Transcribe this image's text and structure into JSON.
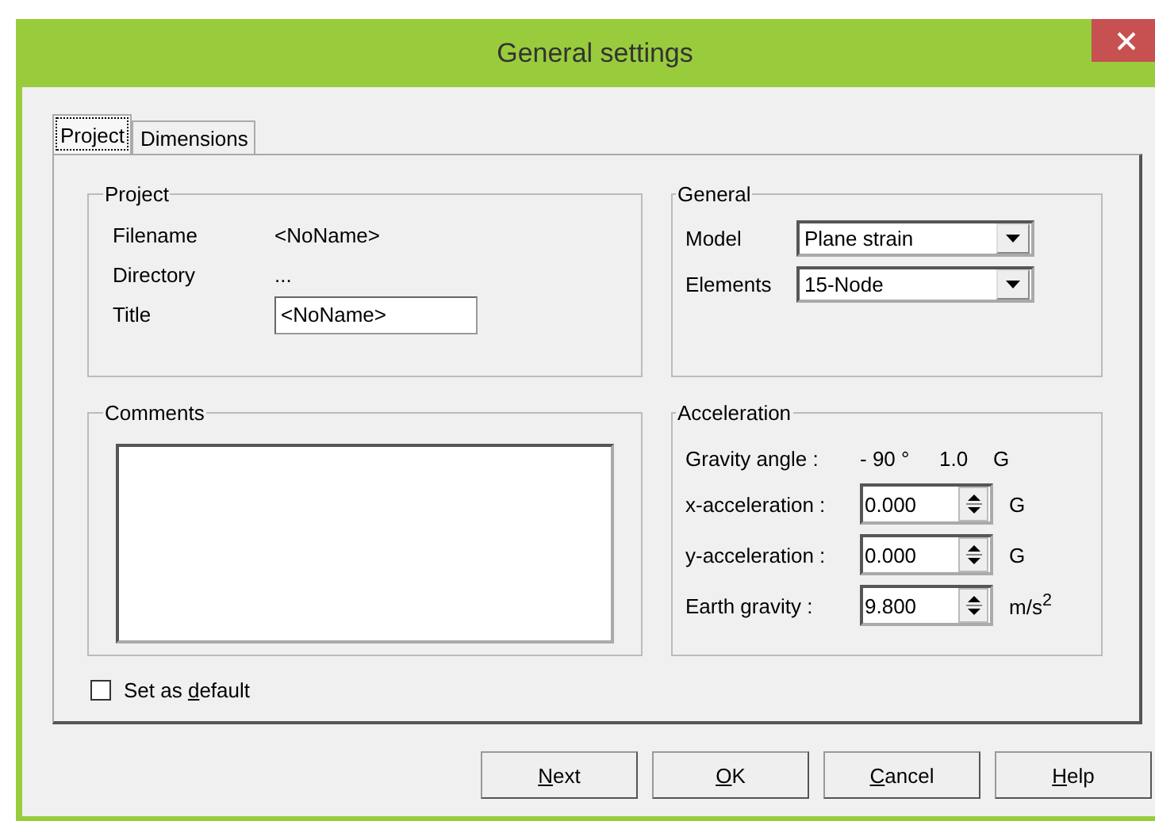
{
  "window": {
    "title": "General settings"
  },
  "tabs": [
    {
      "label": "Project",
      "selected": true
    },
    {
      "label": "Dimensions",
      "selected": false
    }
  ],
  "project": {
    "title": "Project",
    "filename_label": "Filename",
    "filename": "<NoName>",
    "directory_label": "Directory",
    "directory": "...",
    "title_label": "Title",
    "title_value": "<NoName>"
  },
  "general": {
    "title": "General",
    "fields": [
      {
        "label": "Model",
        "value": "Plane strain"
      },
      {
        "label": "Elements",
        "value": "15-Node"
      }
    ]
  },
  "comments": {
    "title": "Comments"
  },
  "acceleration": {
    "title": "Acceleration",
    "gravity_angle_label": "Gravity angle :",
    "gravity_angle": "- 90 °",
    "gravity_value": "1.0",
    "gravity_unit": "G",
    "fields": [
      {
        "label": "x-acceleration :",
        "value": "0.000",
        "unit": "G"
      },
      {
        "label": "y-acceleration :",
        "value": "0.000",
        "unit": "G"
      },
      {
        "label": "Earth gravity :",
        "value": "9.800",
        "unit": "m/s$^{2}$"
      }
    ]
  },
  "set_as_default": {
    "before": "Set as ",
    "hotkey": "d",
    "after": "efault",
    "checked": false
  },
  "buttons": [
    {
      "hotkey": "N",
      "after": "ext"
    },
    {
      "hotkey": "O",
      "after": "K"
    },
    {
      "hotkey": "C",
      "after": "ancel"
    },
    {
      "hotkey": "H",
      "after": "elp"
    }
  ]
}
